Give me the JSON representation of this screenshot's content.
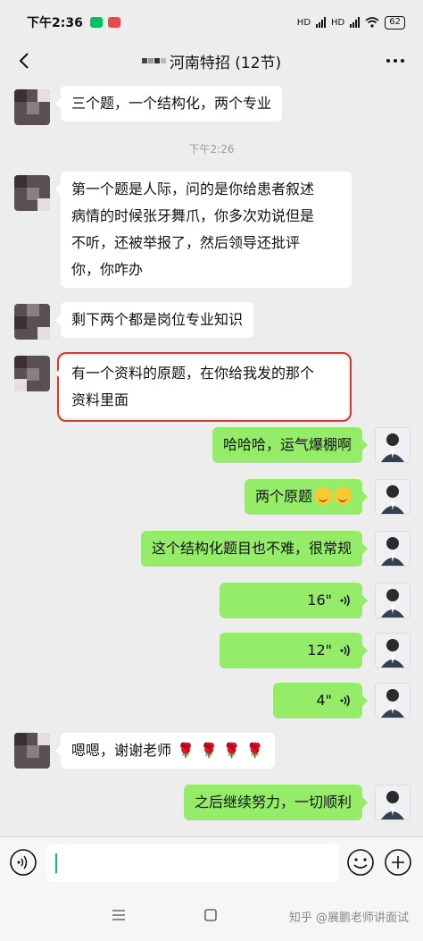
{
  "status": {
    "time": "下午2:36",
    "network_labels": [
      "HD",
      "HD"
    ],
    "battery": "62"
  },
  "header": {
    "title": "河南特招 (12节)"
  },
  "messages": [
    {
      "side": "in",
      "text": "三个题，一个结构化，两个专业"
    },
    {
      "side": "time",
      "text": "下午2:26"
    },
    {
      "side": "in",
      "lines": [
        "第一个题是人际，问的是你给患者叙述",
        "病情的时候张牙舞爪，你多次劝说但是",
        "不听，还被举报了，然后领导还批评",
        "你，你咋办"
      ]
    },
    {
      "side": "in",
      "text": "剩下两个都是岗位专业知识"
    },
    {
      "side": "in",
      "lines": [
        "有一个资料的原题，在你给我发的那个",
        "资料里面"
      ],
      "highlighted": true
    },
    {
      "side": "out",
      "text": "哈哈哈，运气爆棚啊"
    },
    {
      "side": "out",
      "text": "两个原题",
      "emoji": "sly-smile-emoji x2"
    },
    {
      "side": "out",
      "text": "这个结构化题目也不难，很常规"
    },
    {
      "side": "out",
      "voice": "16\""
    },
    {
      "side": "out",
      "voice": "12\""
    },
    {
      "side": "out",
      "voice": "4\""
    },
    {
      "side": "in",
      "text": "嗯嗯，谢谢老师",
      "emoji": "rose x4"
    },
    {
      "side": "out",
      "text": "之后继续努力，一切顺利"
    }
  ],
  "m": {
    "m0": "三个题，一个结构化，两个专业",
    "ts": "下午2:26",
    "m1_l1": "第一个题是人际，问的是你给患者叙述",
    "m1_l2": "病情的时候张牙舞爪，你多次劝说但是",
    "m1_l3": "不听，还被举报了，然后领导还批评",
    "m1_l4": "你，你咋办",
    "m2": "剩下两个都是岗位专业知识",
    "m3_l1": "有一个资料的原题，在你给我发的那个",
    "m3_l2": "资料里面",
    "m4": "哈哈哈，运气爆棚啊",
    "m5": "两个原题",
    "m6": "这个结构化题目也不难，很常规",
    "v1": "16\"",
    "v2": "12\"",
    "v3": "4\"",
    "m7": "嗯嗯，谢谢老师",
    "m8": "之后继续努力，一切顺利"
  },
  "colors": {
    "out_bubble": "#95ec69",
    "in_bubble": "#ffffff",
    "highlight_border": "#d6392e",
    "background": "#ededed"
  },
  "watermark": "知乎 @展鹏老师讲面试"
}
